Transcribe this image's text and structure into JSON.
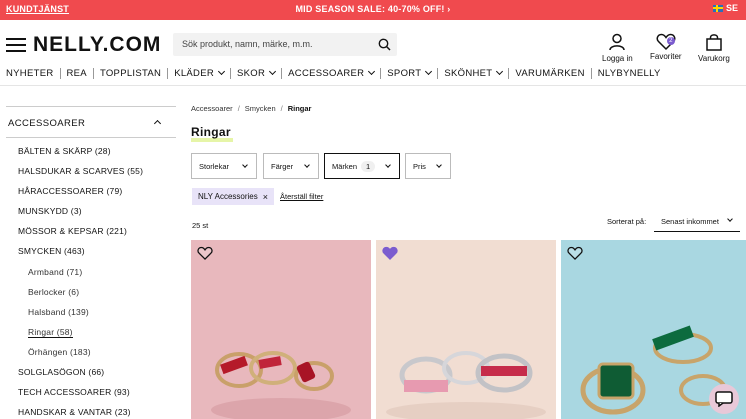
{
  "promo": {
    "customer_service": "KUNDTJÄNST",
    "sale": "MID SEASON SALE: 40-70% OFF! ›",
    "language": "SE"
  },
  "header": {
    "logo": "NELLY.COM",
    "search_placeholder": "Sök produkt, namn, märke, m.m.",
    "login_label": "Logga in",
    "favorites_label": "Favoriter",
    "favorites_count": "2",
    "cart_label": "Varukorg"
  },
  "nav": {
    "items": [
      {
        "label": "NYHETER"
      },
      {
        "label": "REA"
      },
      {
        "label": "TOPPLISTAN"
      },
      {
        "label": "KLÄDER"
      },
      {
        "label": "SKOR"
      },
      {
        "label": "ACCESSOARER"
      },
      {
        "label": "SPORT"
      },
      {
        "label": "SKÖNHET"
      },
      {
        "label": "VARUMÄRKEN"
      },
      {
        "label": "NLYBYNELLY"
      }
    ]
  },
  "sidebar": {
    "heading": "ACCESSOARER",
    "items": [
      {
        "label": "BÄLTEN & SKÄRP (28)"
      },
      {
        "label": "HALSDUKAR & SCARVES (55)"
      },
      {
        "label": "HÅRACCESSOARER (79)"
      },
      {
        "label": "MUNSKYDD (3)"
      },
      {
        "label": "MÖSSOR & KEPSAR (221)"
      },
      {
        "label": "SMYCKEN (463)"
      },
      {
        "label": "Armband (71)"
      },
      {
        "label": "Berlocker (6)"
      },
      {
        "label": "Halsband (139)"
      },
      {
        "label": "Ringar (58)"
      },
      {
        "label": "Örhängen (183)"
      },
      {
        "label": "SOLGLASÖGON (66)"
      },
      {
        "label": "TECH ACCESSOARER (93)"
      },
      {
        "label": "HANDSKAR & VANTAR (23)"
      }
    ]
  },
  "breadcrumb": {
    "level1": "Accessoarer",
    "level2": "Smycken",
    "current": "Ringar",
    "separator": "/"
  },
  "page_title": "Ringar",
  "filters": {
    "size": "Storlekar",
    "color": "Färger",
    "brand": "Märken",
    "brand_count": "1",
    "price": "Pris",
    "active_chip": "NLY Accessories",
    "chip_close": "×",
    "reset": "Återställ filter"
  },
  "results": {
    "count": "25 st",
    "sort_label": "Sorterat på:",
    "sort_value": "Senast inkommet"
  },
  "colors": {
    "promo": "#f04a4e",
    "accent": "#7c5ccf",
    "chip": "#e8e3f8"
  }
}
